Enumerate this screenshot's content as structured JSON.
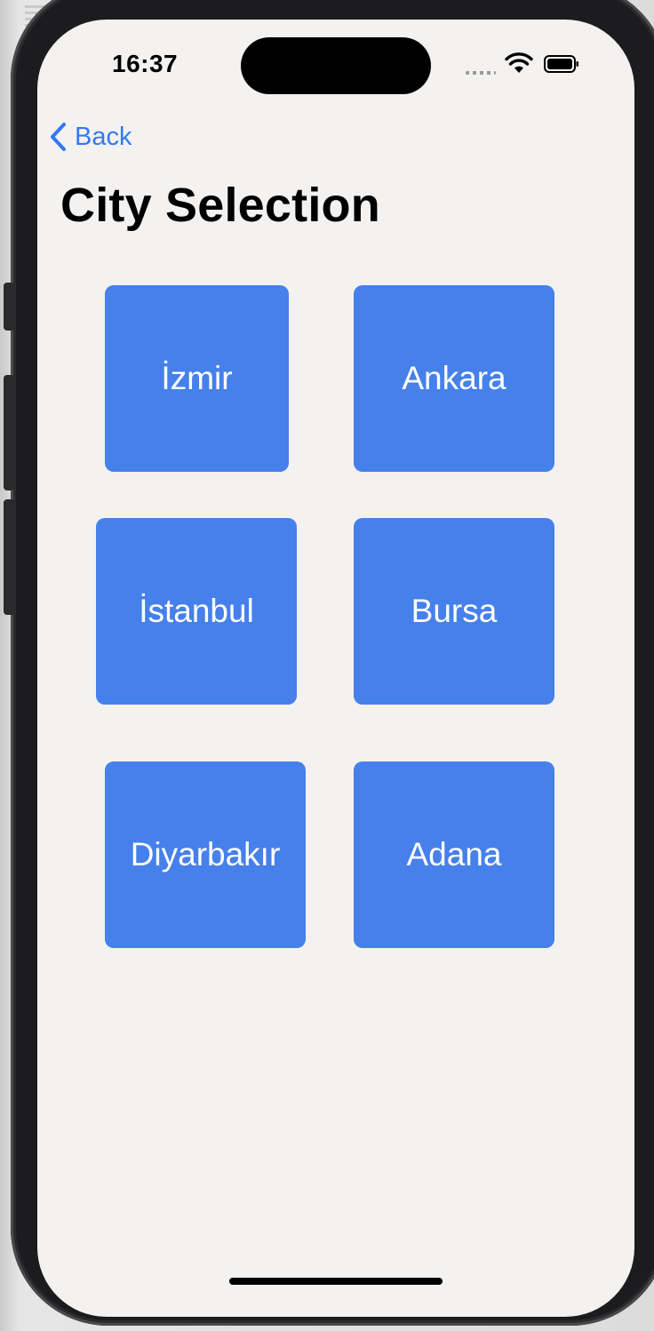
{
  "status_bar": {
    "time": "16:37"
  },
  "navigation": {
    "back_label": "Back"
  },
  "page": {
    "title": "City Selection"
  },
  "cities": [
    "İzmir",
    "Ankara",
    "İstanbul",
    "Bursa",
    "Diyarbakır",
    "Adana"
  ],
  "colors": {
    "accent": "#3478f6",
    "tile": "#4680ea",
    "background": "#f3f2f1"
  }
}
